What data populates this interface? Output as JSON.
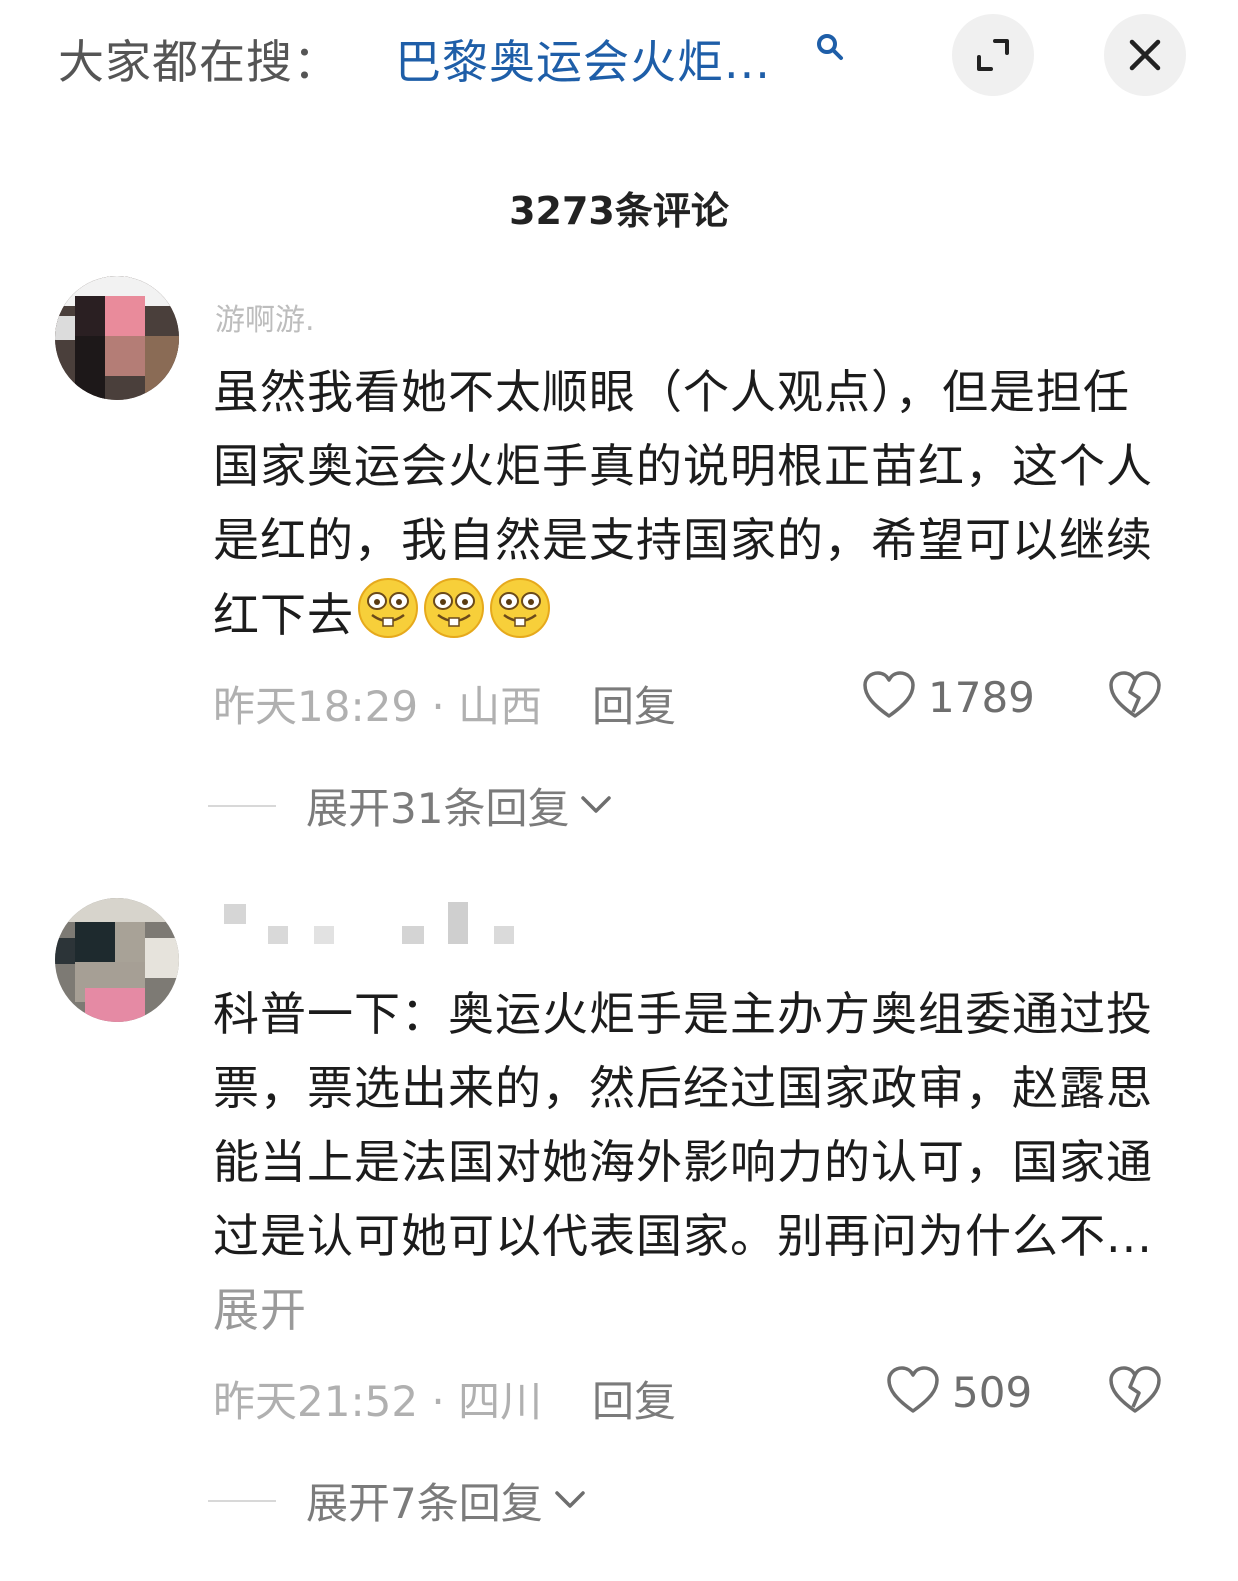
{
  "topbar": {
    "label": "大家都在搜：",
    "query": "巴黎奥运会火炬...",
    "search_icon": "search-icon",
    "expand_icon": "expand-icon",
    "close_icon": "close-icon"
  },
  "comments_header": {
    "count_label": "3273条评论"
  },
  "comments": [
    {
      "username": "游啊游.",
      "text": "虽然我看她不太顺眼（个人观点），但是担任国家奥运会火炬手真的说明根正苗红，这个人是红的，我自然是支持国家的，希望可以继续红下去",
      "emojis": [
        "grin-emoji",
        "grin-emoji",
        "grin-emoji"
      ],
      "time": "昨天18:29 · 山西",
      "reply_label": "回复",
      "likes": "1789",
      "expand_replies": "展开31条回复"
    },
    {
      "username": "",
      "text": "科普一下：奥运火炬手是主办方奥组委通过投票，票选出来的，然后经过国家政审，赵露思能当上是法国对她海外影响力的认可，国家通过是认可她可以代表国家。别再问为什么不...",
      "expand_inline": "展开",
      "time": "昨天21:52 · 四川",
      "reply_label": "回复",
      "likes": "509",
      "expand_replies": "展开7条回复"
    }
  ]
}
